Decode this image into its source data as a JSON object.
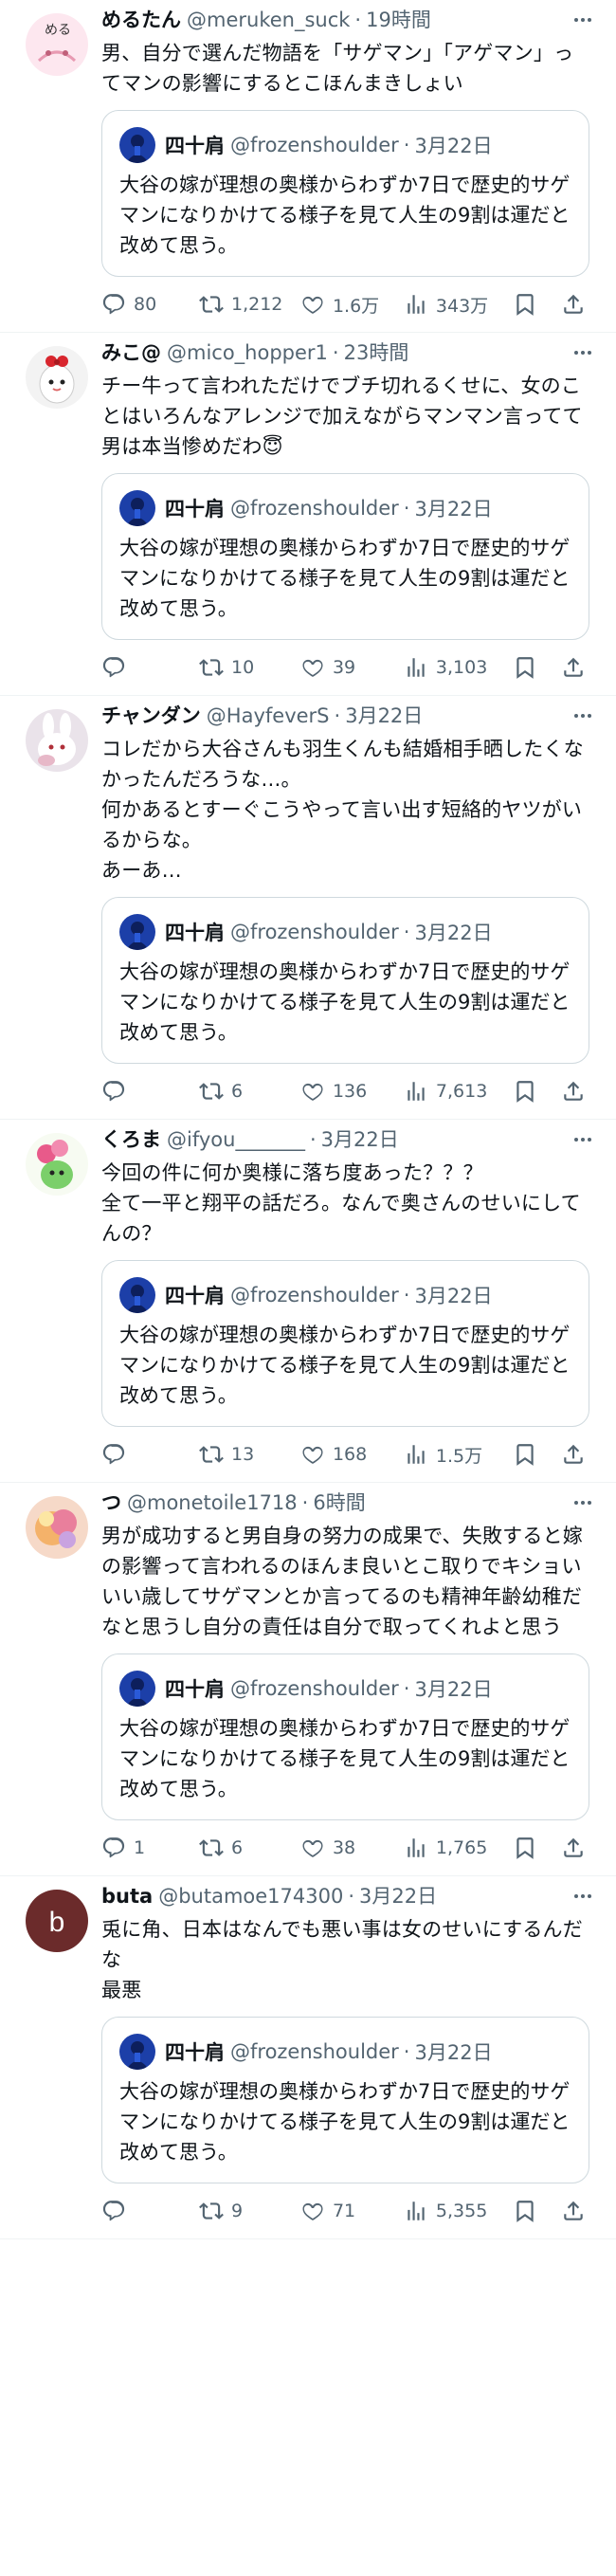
{
  "quoted": {
    "name": "四十肩",
    "handle": "@frozenshoulder",
    "time": "3月22日",
    "text": "大谷の嫁が理想の奥様からわずか7日で歴史的サゲマンになりかけてる様子を見て人生の9割は運だと改めて思う。"
  },
  "tweets": [
    {
      "name": "めるたん",
      "handle": "@meruken_suck",
      "time": "19時間",
      "text": "男、自分で選んだ物語を「サゲマン」「アゲマン」ってマンの影響にするとこほんまきしょい",
      "replies": "80",
      "retweets": "1,212",
      "likes": "1.6万",
      "views": "343万",
      "avatar_text": "める",
      "avatar_color": "#fde7ef"
    },
    {
      "name": "みこ@",
      "handle": "@mico_hopper1",
      "time": "23時間",
      "text": "チー牛って言われただけでブチ切れるくせに、女のことはいろんなアレンジで加えながらマンマン言ってて男は本当惨めだわ😇",
      "replies": "",
      "retweets": "10",
      "likes": "39",
      "views": "3,103",
      "avatar_text": "",
      "avatar_color": "#f3f3f3"
    },
    {
      "name": "チャンダン",
      "handle": "@HayfeverS",
      "time": "3月22日",
      "text": "コレだから大谷さんも羽生くんも結婚相手晒したくなかったんだろうな…。\n何かあるとすーぐこうやって言い出す短絡的ヤツがいるからな。\nあーあ…",
      "replies": "",
      "retweets": "6",
      "likes": "136",
      "views": "7,613",
      "avatar_text": "",
      "avatar_color": "#eae3ea"
    },
    {
      "name": "くろま",
      "handle": "@ifyou_______",
      "time": "3月22日",
      "text": "今回の件に何か奥様に落ち度あった？？？\n全て一平と翔平の話だろ。なんで奥さんのせいにしてんの？",
      "replies": "",
      "retweets": "13",
      "likes": "168",
      "views": "1.5万",
      "avatar_text": "",
      "avatar_color": "#f7fbf2"
    },
    {
      "name": "つ",
      "handle": "@monetoile1718",
      "time": "6時間",
      "text": "男が成功すると男自身の努力の成果で、失敗すると嫁の影響って言われるのほんま良いとこ取りでキショい\nいい歳してサゲマンとか言ってるのも精神年齢幼稚だなと思うし自分の責任は自分で取ってくれよと思う",
      "replies": "1",
      "retweets": "6",
      "likes": "38",
      "views": "1,765",
      "avatar_text": "",
      "avatar_color": "#f6d9c8"
    },
    {
      "name": "buta",
      "handle": "@butamoe174300",
      "time": "3月22日",
      "text": "兎に角、日本はなんでも悪い事は女のせいにするんだな\n最悪",
      "replies": "",
      "retweets": "9",
      "likes": "71",
      "views": "5,355",
      "avatar_text": "b",
      "avatar_color": "#6b2b2b"
    }
  ]
}
